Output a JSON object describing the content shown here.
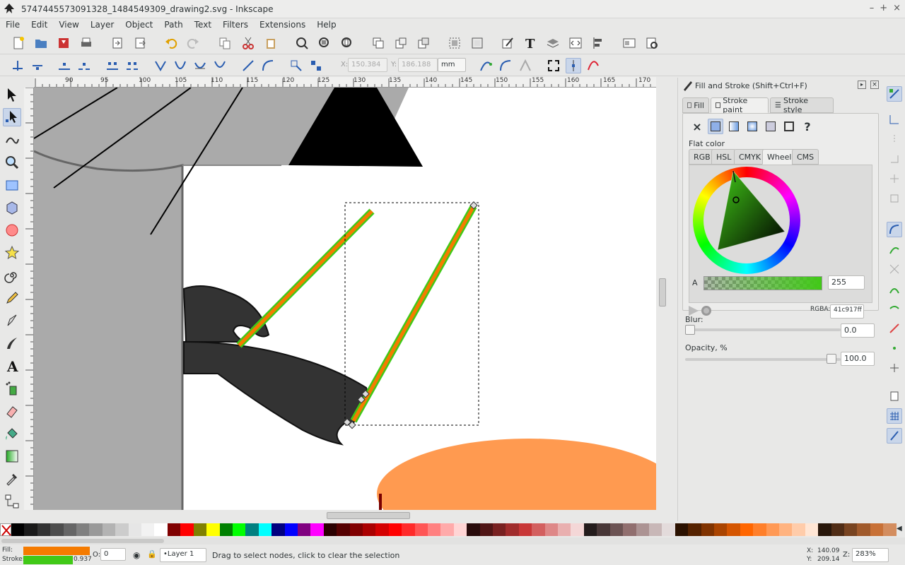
{
  "window": {
    "title": "5747445573091328_1484549309_drawing2.svg - Inkscape",
    "controls": [
      "–",
      "+",
      "×"
    ]
  },
  "menu": [
    "File",
    "Edit",
    "View",
    "Layer",
    "Object",
    "Path",
    "Text",
    "Filters",
    "Extensions",
    "Help"
  ],
  "controls_bar": {
    "x_label": "X:",
    "x_value": "150.384",
    "y_label": "Y:",
    "y_value": "186.188",
    "unit": "mm"
  },
  "rulers": {
    "h_ticks": [
      "90",
      "95",
      "100",
      "105",
      "110",
      "115",
      "120",
      "125",
      "130",
      "135",
      "140",
      "145",
      "150",
      "155",
      "160",
      "165",
      "170"
    ],
    "v_ticks": [
      "1",
      "9",
      "5",
      "1",
      "9",
      "0",
      "1",
      "8",
      "5",
      "1",
      "8",
      "0",
      "1",
      "7",
      "5",
      "1",
      "7",
      "0",
      "1",
      "6",
      "5",
      "1",
      "6",
      "0",
      "1",
      "5",
      "5",
      "1",
      "5",
      "0",
      "1",
      "4",
      "5",
      "1",
      "4"
    ]
  },
  "panel": {
    "title": "Fill and Stroke (Shift+Ctrl+F)",
    "tabs": [
      "Fill",
      "Stroke paint",
      "Stroke style"
    ],
    "active_tab": "Stroke paint",
    "paint_type_label": "Flat color",
    "color_tabs": [
      "RGB",
      "HSL",
      "CMYK",
      "Wheel",
      "CMS"
    ],
    "active_color_tab": "Wheel",
    "alpha_label": "A",
    "alpha_value": "255",
    "rgba_label": "RGBA:",
    "rgba_value": "41c917ff",
    "stroke_color": "#41c917",
    "blur_label": "Blur:",
    "blur_value": "0.0",
    "opacity_label": "Opacity, %",
    "opacity_value": "100.0"
  },
  "status": {
    "fill_label": "Fill:",
    "stroke_label": "Stroke:",
    "fill_color": "#f57b00",
    "stroke_color": "#41c917",
    "stroke_width": "0.937",
    "opacity_label": "O:",
    "opacity_value": "0",
    "layer": "•Layer 1",
    "message": "Drag to select nodes, click to clear the selection",
    "x_label": "X:",
    "x_value": "140.09",
    "y_label": "Y:",
    "y_value": "209.14",
    "zoom_label": "Z:",
    "zoom_value": "283%"
  },
  "palette": [
    "#000000",
    "#1a1a1a",
    "#333333",
    "#4d4d4d",
    "#666666",
    "#808080",
    "#999999",
    "#b3b3b3",
    "#cccccc",
    "#e6e6e6",
    "#f2f2f2",
    "#ffffff",
    "#800000",
    "#ff0000",
    "#808000",
    "#ffff00",
    "#008000",
    "#00ff00",
    "#008080",
    "#00ffff",
    "#000080",
    "#0000ff",
    "#800080",
    "#ff00ff",
    "#2b0000",
    "#550000",
    "#800000",
    "#aa0000",
    "#d40000",
    "#ff0000",
    "#ff2a2a",
    "#ff5555",
    "#ff8080",
    "#ffaaaa",
    "#ffd5d5",
    "#280b0b",
    "#501616",
    "#782121",
    "#a02c2c",
    "#c83737",
    "#d35f5f",
    "#de8787",
    "#e9afaf",
    "#f4d7d7",
    "#241c1c",
    "#483737",
    "#6c5353",
    "#916f6f",
    "#ac9393",
    "#c8b7b7",
    "#e3dbdb",
    "#2b1100",
    "#552200",
    "#803300",
    "#aa4400",
    "#d45500",
    "#ff6600",
    "#ff7f2a",
    "#ff9955",
    "#ffb380",
    "#ffccaa",
    "#ffe6d5",
    "#28170b",
    "#502d16",
    "#784421",
    "#a05a2c",
    "#c87137",
    "#d38d5f"
  ]
}
